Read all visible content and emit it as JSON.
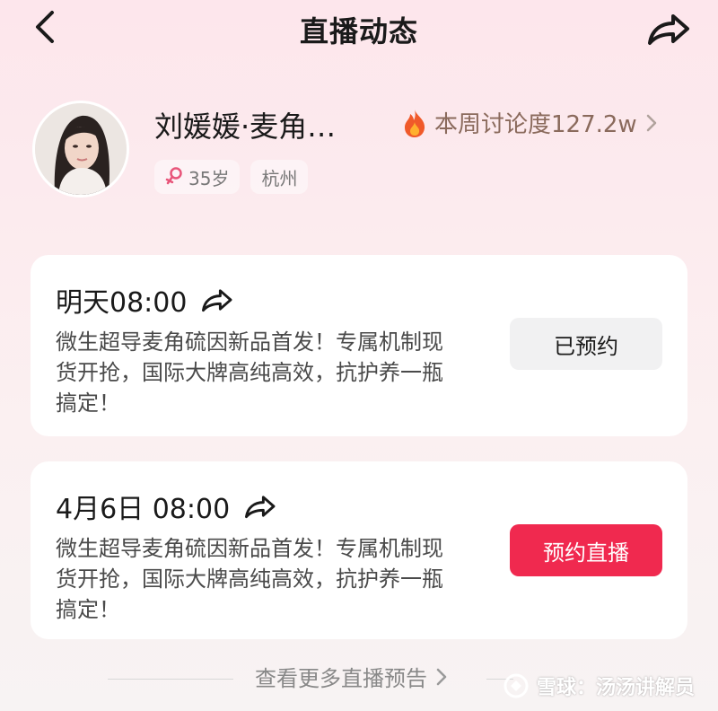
{
  "header": {
    "title": "直播动态",
    "back_icon": "chevron-left-icon",
    "share_icon": "share-arrow-icon"
  },
  "profile": {
    "name": "刘媛媛·麦角…",
    "heat_label": "本周讨论度127.2w",
    "heat_icon": "flame-icon",
    "age": "35岁",
    "city": "杭州"
  },
  "cards": [
    {
      "time": "明天08:00",
      "description": "微生超导麦角硫因新品首发！专属机制现货开抢，国际大牌高纯高效，抗护养一瓶搞定！",
      "button_label": "已预约",
      "state": "reserved"
    },
    {
      "time": "4月6日 08:00",
      "description": "微生超导麦角硫因新品首发！专属机制现货开抢，国际大牌高纯高效，抗护养一瓶搞定！",
      "button_label": "预约直播",
      "state": "not-reserved"
    }
  ],
  "footer": {
    "more_label": "查看更多直播预告"
  },
  "watermark": {
    "text": "雪球：汤汤讲解员"
  },
  "colors": {
    "accent": "#f0294f",
    "heat_text": "#8a6a5c",
    "female_symbol": "#e8557a"
  }
}
